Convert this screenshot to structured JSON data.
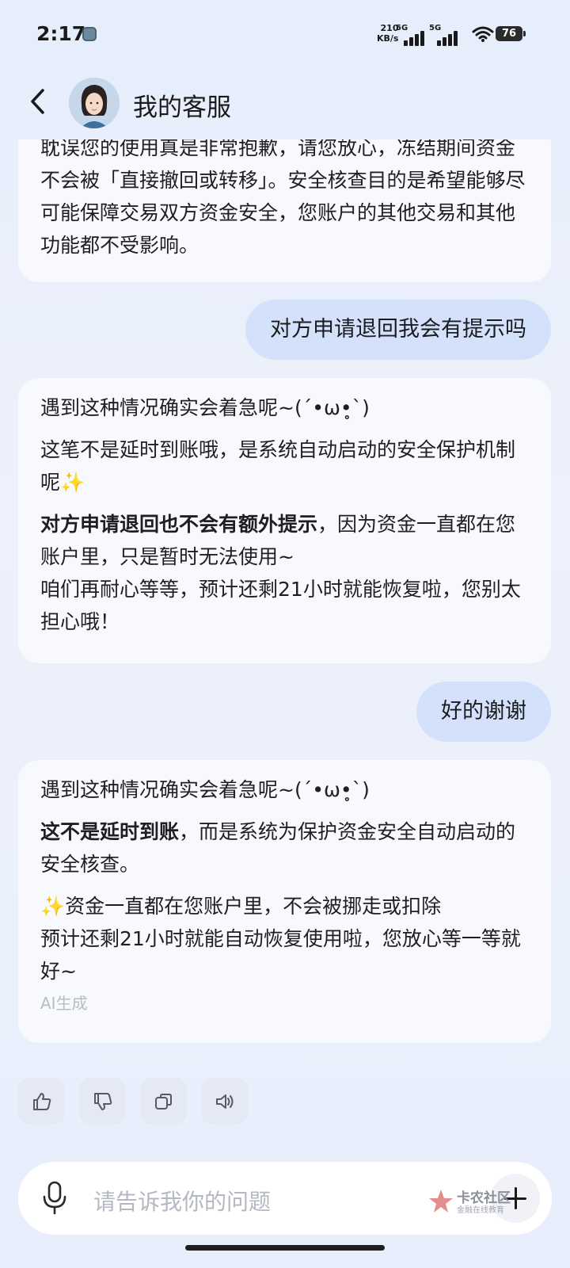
{
  "status_bar": {
    "time": "2:17",
    "net_speed_value": "210",
    "net_speed_unit": "KB/s",
    "sim1_label": "5G",
    "sim2_label": "5G",
    "battery": "76"
  },
  "header": {
    "back_icon": "chevron-left-icon",
    "title": "我的客服"
  },
  "messages": [
    {
      "role": "bot",
      "paragraphs": [
        "耽误您的使用真是非常抱歉，请您放心，冻结期间资金不会被「直接撤回或转移」。安全核查目的是希望能够尽可能保障交易双方资金安全，您账户的其他交易和其他功能都不受影响。"
      ]
    },
    {
      "role": "user",
      "text": "对方申请退回我会有提示吗"
    },
    {
      "role": "bot",
      "p1": "遇到这种情况确实会着急呢~(´•ω•̥`)",
      "p2": "这笔不是延时到账哦，是系统自动启动的安全保护机制呢✨",
      "p3_bold": "对方申请退回也不会有额外提示",
      "p3_rest": "，因为资金一直都在您账户里，只是暂时无法使用~",
      "p3_line2": "咱们再耐心等等，预计还剩21小时就能恢复啦，您别太担心哦！"
    },
    {
      "role": "user",
      "text": "好的谢谢"
    },
    {
      "role": "bot",
      "p1": "遇到这种情况确实会着急呢~(´•ω•̥`)",
      "p2_bold": "这不是延时到账",
      "p2_rest": "，而是系统为保护资金安全自动启动的安全核查。",
      "p3": "✨资金一直都在您账户里，不会被挪走或扣除",
      "p3_line2": "预计还剩21小时就能自动恢复使用啦，您放心等一等就好~",
      "ai_note": "AI生成"
    }
  ],
  "actions": [
    "thumbs-up-icon",
    "thumbs-down-icon",
    "copy-icon",
    "speaker-icon"
  ],
  "input": {
    "placeholder": "请告诉我你的问题",
    "mic_icon": "microphone-icon",
    "plus_icon": "plus-icon"
  },
  "watermark": {
    "line1": "卡农社区",
    "line2": "金融在线教育"
  }
}
